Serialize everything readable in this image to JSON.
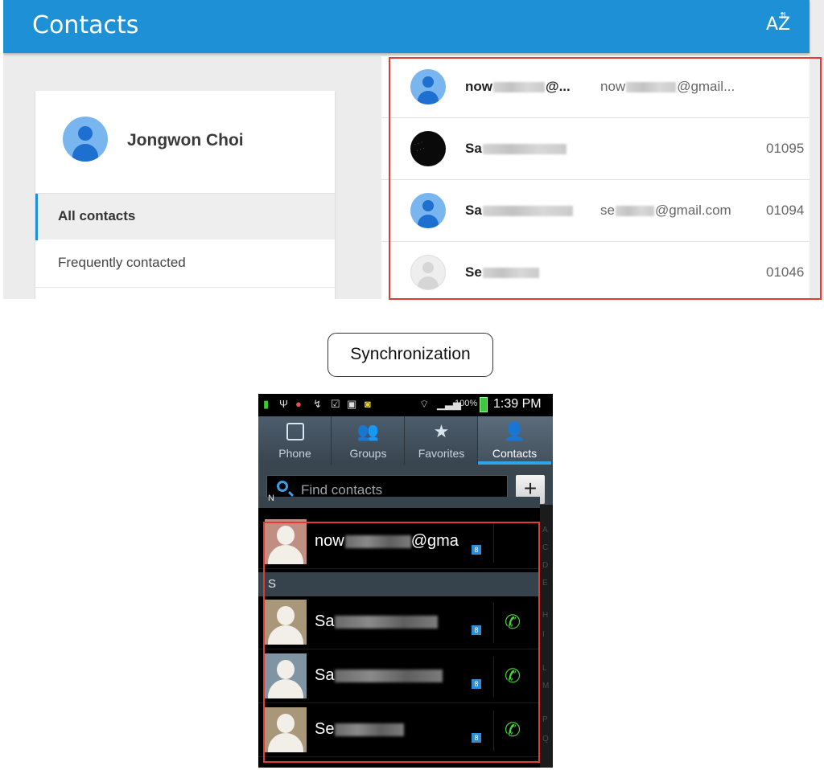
{
  "web": {
    "title": "Contacts",
    "sort_icon_label": "AZ",
    "account": {
      "name": "Jongwon Choi"
    },
    "nav": [
      {
        "label": "All contacts"
      },
      {
        "label": "Frequently contacted"
      }
    ],
    "rows": [
      {
        "name_visible": "now",
        "name_suffix": "@...",
        "email_visible": "now",
        "email_suffix": "@gmail...",
        "phone": ""
      },
      {
        "name_visible": "Sa",
        "name_suffix": "",
        "email_visible": "",
        "email_suffix": "",
        "phone": "01095"
      },
      {
        "name_visible": "Sa",
        "name_suffix": "",
        "email_visible": "se",
        "email_suffix": "@gmail.com",
        "phone": "01094"
      },
      {
        "name_visible": "Se",
        "name_suffix": "",
        "email_visible": "",
        "email_suffix": "",
        "phone": "01046"
      }
    ]
  },
  "sync_label": "Synchronization",
  "phone": {
    "status": {
      "time": "1:39 PM",
      "battery": "100%"
    },
    "tabs": [
      {
        "label": "Phone",
        "icon": "phone-icon"
      },
      {
        "label": "Groups",
        "icon": "groups-icon"
      },
      {
        "label": "Favorites",
        "icon": "star-icon"
      },
      {
        "label": "Contacts",
        "icon": "person-icon"
      }
    ],
    "search": {
      "placeholder": "Find contacts"
    },
    "sections": {
      "n": "N",
      "s": "S"
    },
    "rows": [
      {
        "name_visible": "now",
        "name_suffix": "@gma"
      },
      {
        "name_visible": "Sa",
        "name_suffix": ""
      },
      {
        "name_visible": "Sa",
        "name_suffix": ""
      },
      {
        "name_visible": "Se",
        "name_suffix": ""
      }
    ],
    "index_letters": [
      "A",
      "C",
      "D",
      "E",
      "H",
      "I",
      "L",
      "M",
      "P",
      "Q"
    ]
  },
  "colors": {
    "web_topbar": "#1e90d6",
    "highlight_box": "#e03c31",
    "call_green": "#4ad43a",
    "tab_underline": "#2fa4e7"
  }
}
